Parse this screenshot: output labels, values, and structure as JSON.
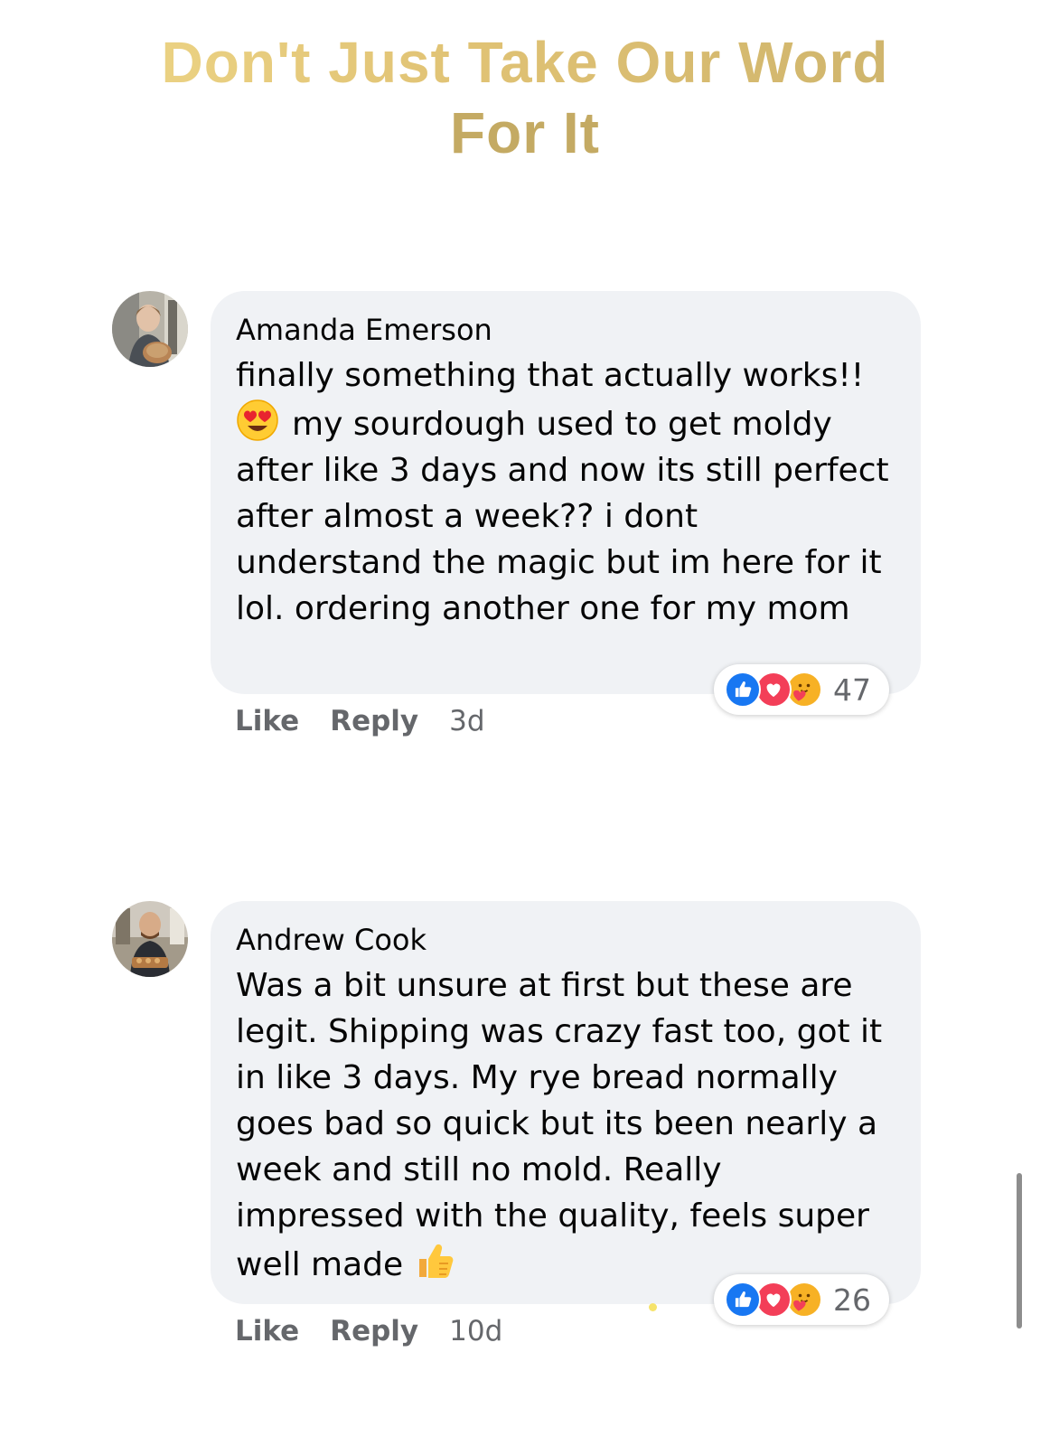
{
  "headline": {
    "line1": "Don't Just Take Our Word",
    "line2": "For It"
  },
  "comments": [
    {
      "author": "Amanda Emerson",
      "text_before_emoji": "finally something that actually works!!",
      "emoji": "heart-eyes-emoji",
      "text_after_emoji": "my sourdough used to get moldy after like 3 days and now its still perfect after almost a week?? i dont understand the magic but im here for it lol. ordering another one for my mom",
      "reaction_icons": [
        "like-icon",
        "love-icon",
        "care-icon"
      ],
      "reaction_count": "47",
      "like_label": "Like",
      "reply_label": "Reply",
      "time": "3d"
    },
    {
      "author": "Andrew Cook",
      "text": "Was a bit unsure at first but these are legit. Shipping was crazy fast too, got it in like 3 days. My rye bread normally goes bad so quick but its been nearly a week and still no mold. Really impressed with the quality, feels super well made",
      "emoji": "thumbs-up-emoji",
      "reaction_icons": [
        "like-icon",
        "love-icon",
        "care-icon"
      ],
      "reaction_count": "26",
      "like_label": "Like",
      "reply_label": "Reply",
      "time": "10d"
    }
  ],
  "colors": {
    "headline_gold": "#c4aa63",
    "bubble_bg": "#f0f2f5",
    "like_blue": "#1877f2",
    "love_red": "#f33e58",
    "meta_gray": "#65676b"
  }
}
